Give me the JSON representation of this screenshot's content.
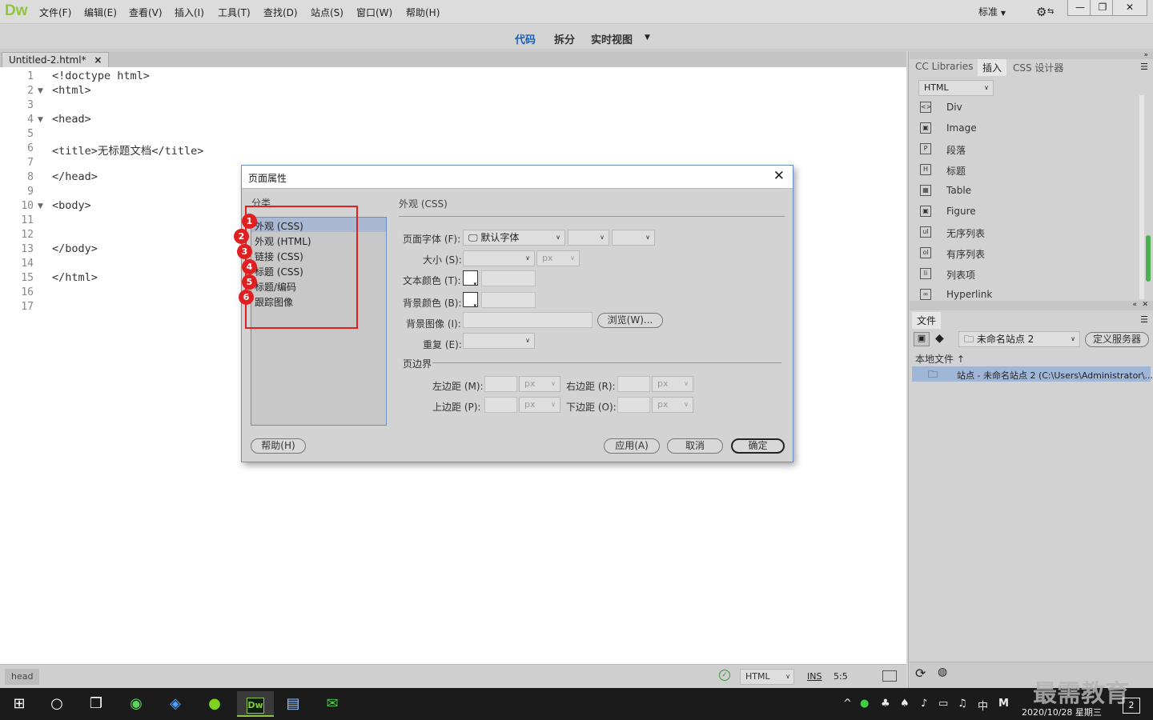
{
  "app": {
    "logo": "Dw",
    "window_controls": {
      "minimize": "—",
      "restore": "❐",
      "close": "✕"
    }
  },
  "menu": [
    "文件(F)",
    "编辑(E)",
    "查看(V)",
    "插入(I)",
    "工具(T)",
    "查找(D)",
    "站点(S)",
    "窗口(W)",
    "帮助(H)"
  ],
  "workspace": {
    "label": "标准"
  },
  "view": {
    "code": "代码",
    "split": "拆分",
    "live": "实时视图"
  },
  "doc_tab": {
    "label": "Untitled-2.html*",
    "close": "×"
  },
  "code_lines": [
    "<!doctype html>",
    "<html>",
    "",
    "<head>",
    "",
    "<title>无标题文档</title>",
    "",
    "</head>",
    "",
    "<body>",
    "",
    "",
    "</body>",
    "",
    "</html>",
    "",
    ""
  ],
  "line_numbers": [
    "1",
    "2",
    "3",
    "4",
    "5",
    "6",
    "7",
    "8",
    "9",
    "10",
    "11",
    "12",
    "13",
    "14",
    "15",
    "16",
    "17"
  ],
  "status": {
    "tag": "head",
    "doc_type": "HTML",
    "ins": "INS",
    "pos": "5:5"
  },
  "right_panel": {
    "tabs": {
      "cc": "CC Libraries",
      "insert": "插入",
      "css": "CSS 设计器"
    },
    "insert_category": "HTML",
    "insert_items": [
      {
        "icon": "<>",
        "label": "Div"
      },
      {
        "icon": "▣",
        "label": "Image"
      },
      {
        "icon": "P",
        "label": "段落"
      },
      {
        "icon": "H",
        "label": "标题"
      },
      {
        "icon": "▦",
        "label": "Table"
      },
      {
        "icon": "▣",
        "label": "Figure"
      },
      {
        "icon": "ul",
        "label": "无序列表"
      },
      {
        "icon": "ol",
        "label": "有序列表"
      },
      {
        "icon": "li",
        "label": "列表项"
      },
      {
        "icon": "∞",
        "label": "Hyperlink"
      }
    ],
    "files": {
      "title": "文件",
      "site_select": "未命名站点 2",
      "define_server": "定义服务器",
      "local_files": "本地文件",
      "site_row": "站点 - 未命名站点 2 (C:\\Users\\Administrator\\..."
    }
  },
  "dialog": {
    "title": "页面属性",
    "category_label": "分类",
    "categories": [
      "外观 (CSS)",
      "外观 (HTML)",
      "链接 (CSS)",
      "标题 (CSS)",
      "标题/编码",
      "跟踪图像"
    ],
    "badges": [
      "1",
      "2",
      "3",
      "4",
      "5",
      "6"
    ],
    "section_title": "外观 (CSS)",
    "page_font_label": "页面字体 (F):",
    "page_font_value": "默认字体",
    "size_label": "大小 (S):",
    "unit_px": "px",
    "text_color_label": "文本颜色 (T):",
    "bg_color_label": "背景颜色 (B):",
    "bg_image_label": "背景图像 (I):",
    "browse_button": "浏览(W)...",
    "repeat_label": "重复 (E):",
    "margins_label": "页边界",
    "left_margin": "左边距 (M):",
    "right_margin": "右边距 (R):",
    "top_margin": "上边距 (P):",
    "bottom_margin": "下边距 (O):",
    "help": "帮助(H)",
    "apply": "应用(A)",
    "cancel": "取消",
    "ok": "确定"
  },
  "taskbar": {
    "clock_date": "2020/10/28 星期三",
    "ime": "中",
    "notif_count": "2",
    "watermark": "最需教育"
  },
  "colors": {
    "highlight": "#e02020",
    "accent": "#1a5fb4",
    "logo": "#8cc63f"
  }
}
